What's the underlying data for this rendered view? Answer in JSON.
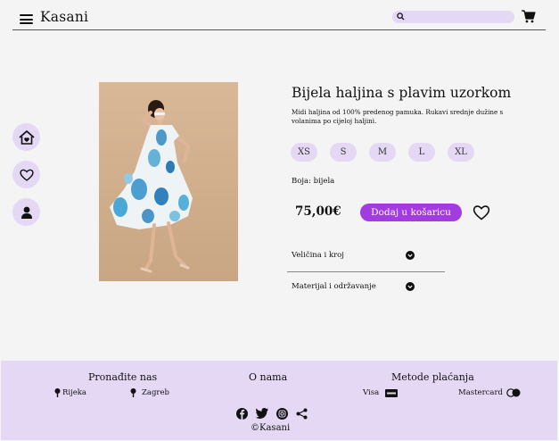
{
  "header": {
    "logo": "Kasani",
    "search_placeholder": ""
  },
  "sidenav": {
    "items": [
      "home",
      "wishlist",
      "profile"
    ]
  },
  "product": {
    "title": "Bijela haljina s plavim uzorkom",
    "description": "Midi haljina od 100% predenog pamuka. Rukavi srednje dužine s volanima po cijeloj haljini.",
    "sizes": [
      "XS",
      "S",
      "M",
      "L",
      "XL"
    ],
    "color_label": "Boja: bijela",
    "price": "75,00€",
    "add_to_cart": "Dodaj u košaricu",
    "accordion": [
      "Veličina i kroj",
      "Materijal i održavanje"
    ]
  },
  "footer": {
    "find_us": "Pronađite nas",
    "locations": [
      "Rijeka",
      "Zagreb"
    ],
    "about": "O nama",
    "payment": "Metode plaćanja",
    "payment_methods": [
      "Visa",
      "Mastercard"
    ],
    "copyright": "Kasani"
  },
  "colors": {
    "accent": "#a23be0",
    "lavender": "#e4d8f4",
    "background": "#f4f4f4"
  }
}
